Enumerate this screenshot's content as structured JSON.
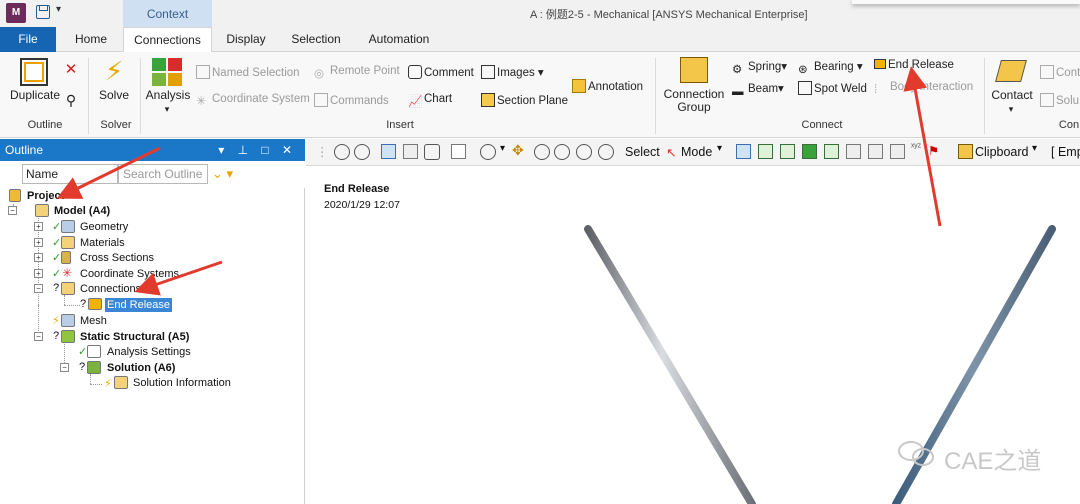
{
  "titlebar": {
    "app_icon": "M",
    "context_tab": "Context",
    "window_title": "A : 例题2-5 - Mechanical [ANSYS Mechanical Enterprise]"
  },
  "tabs": {
    "file": "File",
    "home": "Home",
    "connections": "Connections",
    "display": "Display",
    "selection": "Selection",
    "automation": "Automation"
  },
  "ribbon": {
    "outline_group": {
      "duplicate": "Duplicate",
      "label": "Outline"
    },
    "solver_group": {
      "solve": "Solve",
      "label": "Solver"
    },
    "insert_group": {
      "analysis": "Analysis",
      "named_selection": "Named Selection",
      "coordinate_system": "Coordinate System",
      "remote_point": "Remote Point",
      "commands": "Commands",
      "comment": "Comment",
      "chart": "Chart",
      "images": "Images",
      "section_plane": "Section Plane",
      "annotation": "Annotation",
      "label": "Insert"
    },
    "connect_group": {
      "connection_group": "Connection Group",
      "spring": "Spring",
      "beam": "Beam",
      "bearing": "Bearing",
      "spot_weld": "Spot Weld",
      "end_release": "End Release",
      "body_interaction": "Body Interaction",
      "label": "Connect"
    },
    "contact_group": {
      "contact": "Contact",
      "cont": "Cont",
      "solu": "Solu",
      "label": "Con"
    }
  },
  "outline": {
    "title": "Outline",
    "controls": "▾ ⊥ □ ✕",
    "name_field": "Name",
    "search_placeholder": "Search Outline",
    "tree": {
      "project": "Project*",
      "model": "Model (A4)",
      "geometry": "Geometry",
      "materials": "Materials",
      "cross_sections": "Cross Sections",
      "coordinate_systems": "Coordinate Systems",
      "connections": "Connections",
      "end_release": "End Release",
      "mesh": "Mesh",
      "static_structural": "Static Structural (A5)",
      "analysis_settings": "Analysis Settings",
      "solution": "Solution (A6)",
      "solution_information": "Solution Information"
    }
  },
  "graphics_toolbar": {
    "select": "Select",
    "mode": "Mode",
    "clipboard": "Clipboard",
    "empty": "[ Emp"
  },
  "graphics": {
    "title": "End Release",
    "date": "2020/1/29 12:07",
    "watermark": "CAE之道"
  },
  "colors": {
    "accent": "#1b78c8",
    "file_tab": "#1565b3",
    "arrow": "#e23b2e",
    "beam": "#8a8f98"
  }
}
